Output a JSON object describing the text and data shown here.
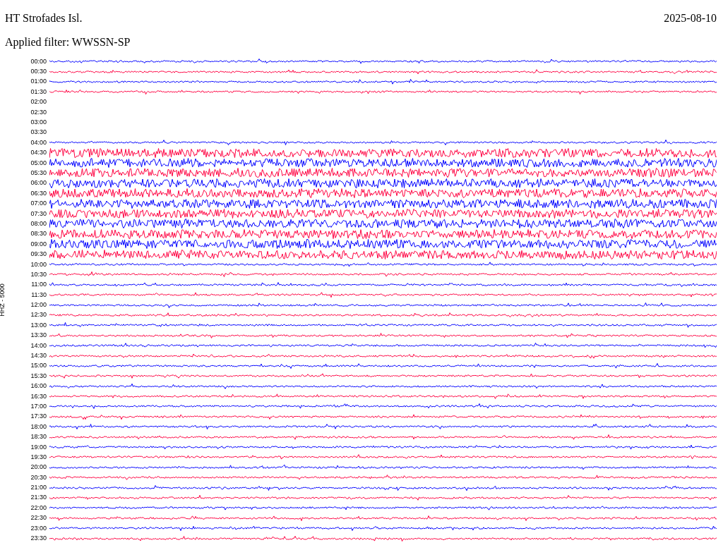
{
  "header": {
    "station": "HT Strofades Isl.",
    "date": "2025-08-10",
    "filter": "Applied filter: WWSSN-SP"
  },
  "axis_label": "HHZ - 5000",
  "rows": [
    {
      "time": "00:00",
      "color": "#0000ff",
      "kind": "trace"
    },
    {
      "time": "00:30",
      "color": "#ff0040",
      "kind": "trace"
    },
    {
      "time": "01:00",
      "color": "#0000ff",
      "kind": "trace"
    },
    {
      "time": "01:30",
      "color": "#ff0040",
      "kind": "trace"
    },
    {
      "time": "02:00",
      "kind": "none"
    },
    {
      "time": "02:30",
      "kind": "none"
    },
    {
      "time": "03:00",
      "kind": "none"
    },
    {
      "time": "03:30",
      "kind": "none"
    },
    {
      "time": "04:00",
      "color": "#0000ff",
      "kind": "trace"
    },
    {
      "time": "04:30",
      "color": "#ff0040",
      "kind": "noisy"
    },
    {
      "time": "05:00",
      "color": "#0000ff",
      "kind": "noisy"
    },
    {
      "time": "05:30",
      "color": "#ff0040",
      "kind": "noisy"
    },
    {
      "time": "06:00",
      "color": "#0000ff",
      "kind": "noisy"
    },
    {
      "time": "06:30",
      "color": "#ff0040",
      "kind": "noisy"
    },
    {
      "time": "07:00",
      "color": "#0000ff",
      "kind": "noisy"
    },
    {
      "time": "07:30",
      "color": "#ff0040",
      "kind": "noisy"
    },
    {
      "time": "08:00",
      "color": "#0000ff",
      "kind": "noisy"
    },
    {
      "time": "08:30",
      "color": "#ff0040",
      "kind": "noisy"
    },
    {
      "time": "09:00",
      "color": "#0000ff",
      "kind": "noisy"
    },
    {
      "time": "09:30",
      "color": "#ff0040",
      "kind": "noisy"
    },
    {
      "time": "10:00",
      "color": "#0000ff",
      "kind": "trace"
    },
    {
      "time": "10:30",
      "color": "#ff0040",
      "kind": "trace"
    },
    {
      "time": "11:00",
      "color": "#0000ff",
      "kind": "trace"
    },
    {
      "time": "11:30",
      "color": "#ff0040",
      "kind": "trace"
    },
    {
      "time": "12:00",
      "color": "#0000ff",
      "kind": "trace"
    },
    {
      "time": "12:30",
      "color": "#ff0040",
      "kind": "trace"
    },
    {
      "time": "13:00",
      "color": "#0000ff",
      "kind": "trace"
    },
    {
      "time": "13:30",
      "color": "#ff0040",
      "kind": "trace"
    },
    {
      "time": "14:00",
      "color": "#0000ff",
      "kind": "trace"
    },
    {
      "time": "14:30",
      "color": "#ff0040",
      "kind": "trace"
    },
    {
      "time": "15:00",
      "color": "#0000ff",
      "kind": "trace"
    },
    {
      "time": "15:30",
      "color": "#ff0040",
      "kind": "trace"
    },
    {
      "time": "16:00",
      "color": "#0000ff",
      "kind": "trace"
    },
    {
      "time": "16:30",
      "color": "#ff0040",
      "kind": "trace"
    },
    {
      "time": "17:00",
      "color": "#0000ff",
      "kind": "trace"
    },
    {
      "time": "17:30",
      "color": "#ff0040",
      "kind": "trace"
    },
    {
      "time": "18:00",
      "color": "#0000ff",
      "kind": "trace"
    },
    {
      "time": "18:30",
      "color": "#ff0040",
      "kind": "trace"
    },
    {
      "time": "19:00",
      "color": "#0000ff",
      "kind": "trace"
    },
    {
      "time": "19:30",
      "color": "#ff0040",
      "kind": "trace"
    },
    {
      "time": "20:00",
      "color": "#0000ff",
      "kind": "trace"
    },
    {
      "time": "20:30",
      "color": "#ff0040",
      "kind": "trace"
    },
    {
      "time": "21:00",
      "color": "#0000ff",
      "kind": "trace"
    },
    {
      "time": "21:30",
      "color": "#ff0040",
      "kind": "trace"
    },
    {
      "time": "22:00",
      "color": "#0000ff",
      "kind": "trace"
    },
    {
      "time": "22:30",
      "color": "#ff0040",
      "kind": "trace"
    },
    {
      "time": "23:00",
      "color": "#0000ff",
      "kind": "trace"
    },
    {
      "time": "23:30",
      "color": "#ff0040",
      "kind": "trace"
    }
  ]
}
